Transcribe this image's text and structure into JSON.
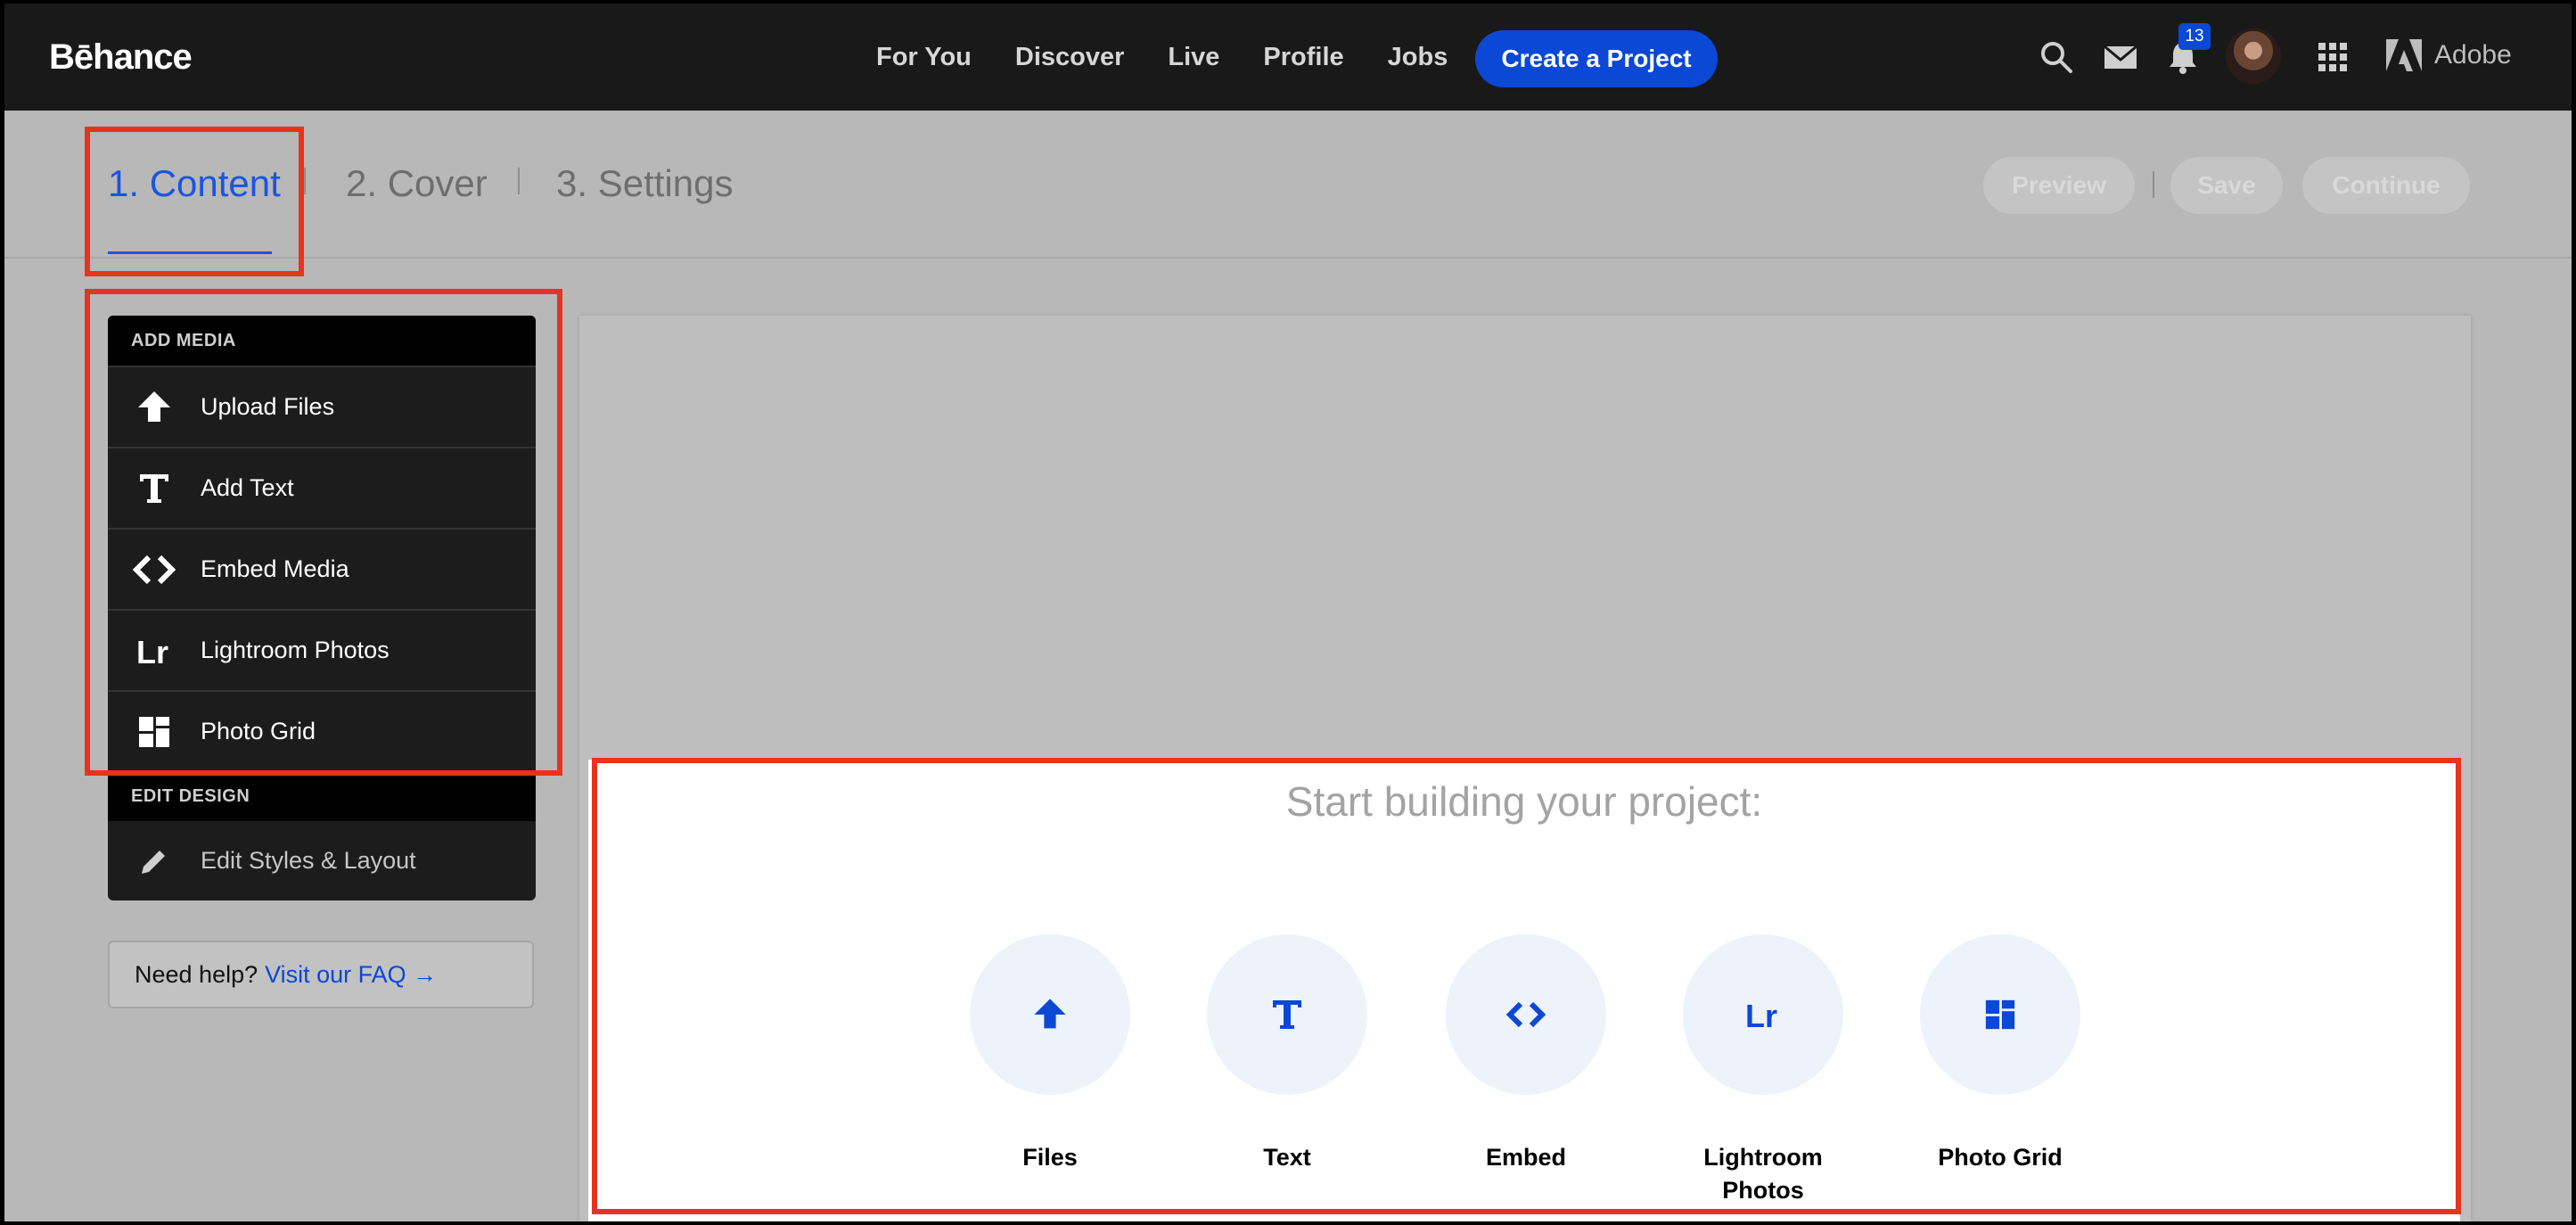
{
  "nav": {
    "logo": "Bēhance",
    "links": [
      "For You",
      "Discover",
      "Live",
      "Profile",
      "Jobs"
    ],
    "create_label": "Create a Project",
    "notification_count": "13",
    "adobe_label": "Adobe",
    "icons": [
      "search-icon",
      "mail-icon",
      "bell-icon",
      "apps-grid-icon",
      "adobe-logo-icon"
    ]
  },
  "steps": {
    "items": [
      "1. Content",
      "2. Cover",
      "3. Settings"
    ],
    "active": "1. Content",
    "actions": [
      "Preview",
      "Save",
      "Continue"
    ]
  },
  "sidebar": {
    "add_media_heading": "ADD MEDIA",
    "items": [
      {
        "label": "Upload Files",
        "icon": "upload-arrow-icon"
      },
      {
        "label": "Add Text",
        "icon": "text-t-icon"
      },
      {
        "label": "Embed Media",
        "icon": "embed-code-icon"
      },
      {
        "label": "Lightroom Photos",
        "icon": "lightroom-icon"
      },
      {
        "label": "Photo Grid",
        "icon": "photo-grid-icon"
      }
    ],
    "edit_design_heading": "EDIT DESIGN",
    "edit_item": {
      "label": "Edit Styles & Layout",
      "icon": "pencil-icon"
    }
  },
  "help": {
    "text": "Need help?",
    "link": "Visit our FAQ →"
  },
  "start": {
    "title": "Start building your project:",
    "tiles": [
      {
        "label": "Files",
        "icon": "upload-arrow-icon"
      },
      {
        "label": "Text",
        "icon": "text-t-icon"
      },
      {
        "label": "Embed",
        "icon": "embed-code-icon"
      },
      {
        "label": "Lightroom Photos",
        "icon": "lightroom-icon"
      },
      {
        "label": "Photo Grid",
        "icon": "photo-grid-icon"
      }
    ]
  },
  "colors": {
    "accent": "#0b48d6",
    "annotation": "#e8341c",
    "nav_bg": "#191919",
    "overlay_bg": "#b8b8b8"
  }
}
